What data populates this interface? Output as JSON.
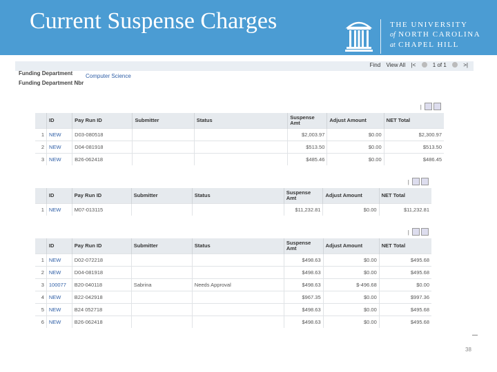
{
  "header": {
    "title": "Current Suspense Charges",
    "university": {
      "line1": "THE UNIVERSITY",
      "line2_prefix": "of",
      "line2": "NORTH CAROLINA",
      "line3_prefix": "at",
      "line3": "CHAPEL HILL"
    },
    "brand_color": "#4b9cd3"
  },
  "nav": {
    "find": "Find",
    "view_all": "View All",
    "first": "|<",
    "range": "1 of 1",
    "last": ">|"
  },
  "funding": {
    "dept_label": "Funding Department",
    "dept_value": "Computer Science",
    "nbr_label": "Funding Department Nbr"
  },
  "columns": {
    "id": "ID",
    "pay_run": "Pay Run ID",
    "submitter": "Submitter",
    "status": "Status",
    "suspense": "Suspense Amt",
    "adjust": "Adjust Amount",
    "net": "NET Total"
  },
  "grids": [
    {
      "rows": [
        {
          "n": "1",
          "id": "NEW",
          "pay_run": "D03-080518",
          "submitter": "",
          "status": "",
          "suspense": "$2,003.97",
          "adjust": "$0.00",
          "net": "$2,300.97"
        },
        {
          "n": "2",
          "id": "NEW",
          "pay_run": "D04-081918",
          "submitter": "",
          "status": "",
          "suspense": "$513.50",
          "adjust": "$0.00",
          "net": "$513.50"
        },
        {
          "n": "3",
          "id": "NEW",
          "pay_run": "B26-062418",
          "submitter": "",
          "status": "",
          "suspense": "$485.46",
          "adjust": "$0.00",
          "net": "$486.45"
        }
      ]
    },
    {
      "rows": [
        {
          "n": "1",
          "id": "NEW",
          "pay_run": "M07-013115",
          "submitter": "",
          "status": "",
          "suspense": "$11,232.81",
          "adjust": "$0.00",
          "net": "$11,232.81"
        }
      ]
    },
    {
      "rows": [
        {
          "n": "1",
          "id": "NEW",
          "pay_run": "D02-072218",
          "submitter": "",
          "status": "",
          "suspense": "$498.63",
          "adjust": "$0.00",
          "net": "$495.68"
        },
        {
          "n": "2",
          "id": "NEW",
          "pay_run": "D04-081918",
          "submitter": "",
          "status": "",
          "suspense": "$498.63",
          "adjust": "$0.00",
          "net": "$495.68"
        },
        {
          "n": "3",
          "id": "100077",
          "pay_run": "B20-040118",
          "submitter": "Sabrina",
          "status": "Needs Approval",
          "suspense": "$498.63",
          "adjust": "$-496.68",
          "net": "$0.00"
        },
        {
          "n": "4",
          "id": "NEW",
          "pay_run": "B22-042918",
          "submitter": "",
          "status": "",
          "suspense": "$967.35",
          "adjust": "$0.00",
          "net": "$997.36"
        },
        {
          "n": "5",
          "id": "NEW",
          "pay_run": "B24 052718",
          "submitter": "",
          "status": "",
          "suspense": "$498.63",
          "adjust": "$0.00",
          "net": "$495.68"
        },
        {
          "n": "6",
          "id": "NEW",
          "pay_run": "B26-062418",
          "submitter": "",
          "status": "",
          "suspense": "$498.63",
          "adjust": "$0.00",
          "net": "$495.68"
        }
      ]
    }
  ],
  "slide_number": "38"
}
